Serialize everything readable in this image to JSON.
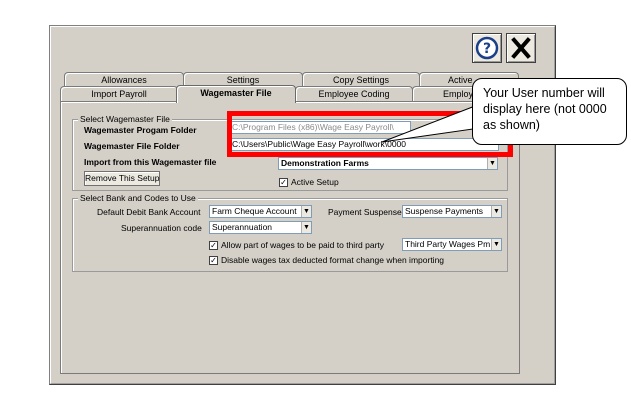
{
  "window": {
    "help_icon": "question-circle-icon",
    "close_icon": "x-close-icon"
  },
  "tabs": {
    "row1": [
      "Allowances",
      "Settings",
      "Copy Settings",
      "Active"
    ],
    "row2": [
      "Import Payroll",
      "Wagemaster File",
      "Employee Coding",
      "Employee"
    ],
    "active": "Wagemaster File"
  },
  "wagemaster": {
    "legend": "Select Wagemaster File",
    "program_folder_label": "Wagemaster Progam Folder",
    "program_folder_value": "C:\\Program Files (x86)\\Wage Easy Payroll\\",
    "file_folder_label": "Wagemaster File Folder",
    "file_folder_value": "C:\\Users\\Public\\Wage Easy Payroll\\work\\0000",
    "import_label": "Import from this Wagemaster file",
    "import_value": "Demonstration Farms",
    "remove_button": "Remove This Setup",
    "active_setup_label": "Active Setup",
    "active_setup_checked": true
  },
  "bank": {
    "legend": "Select Bank and Codes to Use",
    "debit_label": "Default Debit Bank Account",
    "debit_value": "Farm Cheque Account",
    "suspense_label": "Payment Suspense",
    "suspense_value": "Suspense Payments",
    "super_label": "Superannuation code",
    "super_value": "Superannuation",
    "third_party_label": "Allow part of wages to be paid to third party",
    "third_party_checked": true,
    "third_party_value": "Third Party Wages Pm",
    "disable_tax_label": "Disable wages tax deducted format change when importing",
    "disable_tax_checked": true
  },
  "callout": {
    "text": "Your User number will display here (not 0000 as shown)"
  },
  "colors": {
    "highlight": "#ff0000",
    "window_bg": "#d4d0c8"
  }
}
